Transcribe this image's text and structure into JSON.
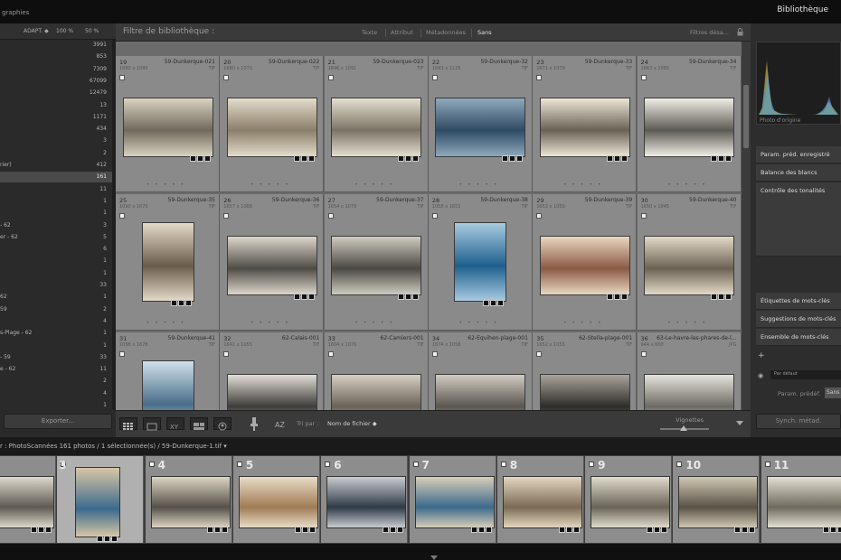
{
  "topbar": {
    "app_title": "graphies",
    "module": "Bibliothèque"
  },
  "left": {
    "header": {
      "adapt": "ADAPT. ◆",
      "zoom1": "100 %",
      "zoom2": "50 %"
    },
    "folders": [
      {
        "name": "",
        "count": "3991"
      },
      {
        "name": "",
        "count": "853"
      },
      {
        "name": "",
        "count": "7309"
      },
      {
        "name": "",
        "count": "67099"
      },
      {
        "name": "",
        "count": "12479"
      },
      {
        "name": "",
        "count": "13"
      },
      {
        "name": "",
        "count": "1171"
      },
      {
        "name": "",
        "count": "434"
      },
      {
        "name": "",
        "count": "3"
      },
      {
        "name": "",
        "count": "2"
      },
      {
        "name": "rier)",
        "count": "412"
      },
      {
        "name": "",
        "count": "161",
        "selected": true
      },
      {
        "name": "",
        "count": "11"
      },
      {
        "name": "",
        "count": "1"
      },
      {
        "name": "",
        "count": "1"
      },
      {
        "name": "- 62",
        "count": "3"
      },
      {
        "name": "er - 62",
        "count": "5"
      },
      {
        "name": "",
        "count": "6"
      },
      {
        "name": "",
        "count": "1"
      },
      {
        "name": "",
        "count": "1"
      },
      {
        "name": "",
        "count": "33"
      },
      {
        "name": "62",
        "count": "1"
      },
      {
        "name": "59",
        "count": "2"
      },
      {
        "name": "",
        "count": "4"
      },
      {
        "name": "s-Plage - 62",
        "count": "1"
      },
      {
        "name": "",
        "count": "1"
      },
      {
        "name": "- 59",
        "count": "33"
      },
      {
        "name": "e - 62",
        "count": "11"
      },
      {
        "name": "",
        "count": "2"
      },
      {
        "name": "",
        "count": "4"
      },
      {
        "name": "",
        "count": "1"
      }
    ],
    "export_label": "Exporter..."
  },
  "filter": {
    "title": "Filtre de bibliothèque :",
    "options": [
      "Texte",
      "Attribut",
      "Métadonnées",
      "Sans"
    ],
    "active": "Sans",
    "right": "Filtres désa..."
  },
  "grid": {
    "cells": [
      {
        "idx": "19",
        "name": "59-Dunkerque-021",
        "dims": "1680 x 1080",
        "ext": "TIF",
        "sel": false,
        "portrait": false,
        "tone": [
          "#6f6a5c",
          "#d8d2c0"
        ]
      },
      {
        "idx": "20",
        "name": "59-Dunkerque-022",
        "dims": "1680 x 1070",
        "ext": "TIF",
        "sel": false,
        "portrait": false,
        "tone": [
          "#8a7f6a",
          "#e3dccb"
        ]
      },
      {
        "idx": "21",
        "name": "59-Dunkerque-023",
        "dims": "1696 x 1091",
        "ext": "TIF",
        "sel": false,
        "portrait": false,
        "tone": [
          "#7a7466",
          "#e5dfd0"
        ]
      },
      {
        "idx": "22",
        "name": "59-Dunkerque-32",
        "dims": "1693 x 1125",
        "ext": "TIF",
        "sel": false,
        "portrait": false,
        "tone": [
          "#2f4a63",
          "#8fa9bd"
        ]
      },
      {
        "idx": "23",
        "name": "59-Dunkerque-33",
        "dims": "1671 x 1079",
        "ext": "TIF",
        "sel": false,
        "portrait": false,
        "tone": [
          "#6a6255",
          "#ece6d6"
        ]
      },
      {
        "idx": "24",
        "name": "59-Dunkerque-34",
        "dims": "1663 x 1065",
        "ext": "TIF",
        "sel": false,
        "portrait": false,
        "tone": [
          "#5c5a55",
          "#f0ede4"
        ]
      },
      {
        "idx": "25",
        "name": "59-Dunkerque-35",
        "dims": "1090 x 1670",
        "ext": "TIF",
        "sel": false,
        "portrait": true,
        "tone": [
          "#6a5c4b",
          "#e4dac8"
        ]
      },
      {
        "idx": "26",
        "name": "59-Dunkerque-36",
        "dims": "1657 x 1088",
        "ext": "TIF",
        "sel": false,
        "portrait": false,
        "tone": [
          "#4f4c47",
          "#dcd6ca"
        ]
      },
      {
        "idx": "27",
        "name": "59-Dunkerque-37",
        "dims": "1654 x 1079",
        "ext": "TIF",
        "sel": false,
        "portrait": false,
        "tone": [
          "#4a4843",
          "#cfcbc0"
        ]
      },
      {
        "idx": "28",
        "name": "59-Dunkerque-38",
        "dims": "1058 x 1653",
        "ext": "TIF",
        "sel": false,
        "portrait": true,
        "tone": [
          "#1f5f8e",
          "#a8cbe0"
        ]
      },
      {
        "idx": "29",
        "name": "59-Dunkerque-39",
        "dims": "1652 x 1059",
        "ext": "TIF",
        "sel": false,
        "portrait": false,
        "tone": [
          "#8a5a44",
          "#e9d7c2"
        ]
      },
      {
        "idx": "30",
        "name": "59-Dunkerque-40",
        "dims": "1650 x 1045",
        "ext": "TIF",
        "sel": false,
        "portrait": false,
        "tone": [
          "#6b6254",
          "#e3d9c6"
        ]
      },
      {
        "idx": "31",
        "name": "59-Dunkerque-41",
        "dims": "1098 x 1678",
        "ext": "TIF",
        "sel": false,
        "portrait": true,
        "tone": [
          "#4a6f8a",
          "#cfe0ea"
        ]
      },
      {
        "idx": "32",
        "name": "62-Calais-001",
        "dims": "1641 x 1055",
        "ext": "TIF",
        "sel": false,
        "portrait": false,
        "tone": [
          "#3e3c39",
          "#e2ded6"
        ]
      },
      {
        "idx": "33",
        "name": "62-Camiers-001",
        "dims": "1604 x 1076",
        "ext": "TIF",
        "sel": false,
        "portrait": false,
        "tone": [
          "#6a6257",
          "#d6cfc2"
        ]
      },
      {
        "idx": "34",
        "name": "62-Equihen-plage-001",
        "dims": "1674 x 1056",
        "ext": "TIF",
        "sel": false,
        "portrait": false,
        "tone": [
          "#5a5650",
          "#d0ccc3"
        ]
      },
      {
        "idx": "35",
        "name": "62-Stella-plage-001",
        "dims": "1652 x 1055",
        "ext": "TIF",
        "sel": false,
        "portrait": false,
        "tone": [
          "#2e2c2a",
          "#a9a49b"
        ]
      },
      {
        "idx": "36",
        "name": "63-Le-havre-les-phares-de-l...",
        "dims": "944 x 600",
        "ext": "JPG",
        "sel": false,
        "portrait": false,
        "tone": [
          "#6d6a63",
          "#e6e3dc"
        ]
      }
    ]
  },
  "toolbar": {
    "sort_label": "Tri par :",
    "sort_value": "Nom de fichier ◆",
    "vignettes": "Vignettes"
  },
  "right": {
    "photo_orig": "Photo d'origine",
    "quick": [
      "Param. préd. enregistré",
      "Balance des blancs",
      "Contrôle des tonalités"
    ],
    "keywords": [
      "Étiquettes de mots-clés",
      "Suggestions de mots-clés",
      "Ensemble de mots-clés"
    ],
    "par_defaut": "Par défaut",
    "param_predef": "Param. prédéf.",
    "sans": "Sans",
    "sync": "Synch. métad."
  },
  "filmbar": {
    "info": "r : PhotoScannées     161 photos / 1 sélectionnée(s) / 59-Dunkerque-1.tif ▾"
  },
  "filmstrip": [
    {
      "num": "",
      "sel": false,
      "portrait": false,
      "tone": [
        "#5e5a52",
        "#ddd8cc"
      ]
    },
    {
      "num": "3",
      "sel": true,
      "portrait": true,
      "tone": [
        "#3b6a8c",
        "#d8c6a6"
      ]
    },
    {
      "num": "4",
      "sel": false,
      "portrait": false,
      "tone": [
        "#555049",
        "#dcd5c3"
      ]
    },
    {
      "num": "5",
      "sel": false,
      "portrait": false,
      "tone": [
        "#a07b55",
        "#e8dcc6"
      ]
    },
    {
      "num": "6",
      "sel": false,
      "portrait": false,
      "tone": [
        "#2f3a48",
        "#c9ccd0"
      ]
    },
    {
      "num": "7",
      "sel": false,
      "portrait": false,
      "tone": [
        "#3c6a8c",
        "#d9cdb8"
      ]
    },
    {
      "num": "8",
      "sel": false,
      "portrait": false,
      "tone": [
        "#7a6a55",
        "#e3d6be"
      ]
    },
    {
      "num": "9",
      "sel": false,
      "portrait": false,
      "tone": [
        "#6a6458",
        "#e1dbcc"
      ]
    },
    {
      "num": "10",
      "sel": false,
      "portrait": false,
      "tone": [
        "#5a5246",
        "#d0c7b3"
      ]
    },
    {
      "num": "11",
      "sel": false,
      "portrait": false,
      "tone": [
        "#6e6a5f",
        "#e4dfd2"
      ]
    }
  ]
}
